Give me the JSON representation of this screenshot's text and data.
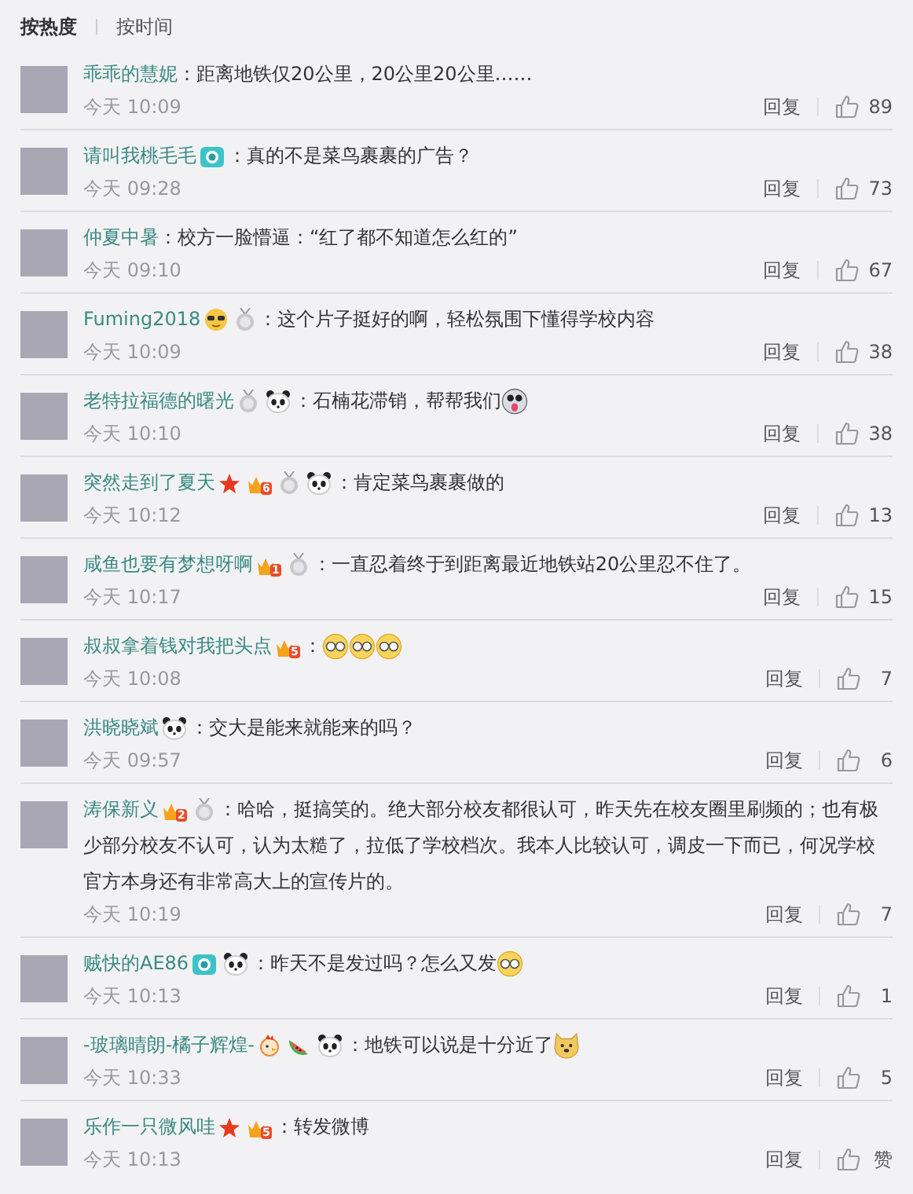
{
  "sort_tabs": [
    {
      "label": "按热度",
      "selected": true
    },
    {
      "label": "按时间",
      "selected": false
    }
  ],
  "comments": [
    {
      "name": "乖乖的慧妮",
      "text": "：距离地铁仅20公里，20公里20公里……",
      "time": "今天 10:09",
      "reply": "回复",
      "likes": "89"
    },
    {
      "name": "请叫我桃毛毛",
      "badges": [
        {
          "kind": "camera"
        }
      ],
      "text": "：真的不是菜鸟裹裹的广告？",
      "time": "今天 09:28",
      "reply": "回复",
      "likes": "73"
    },
    {
      "name": "仲夏中暑",
      "text": "：校方一脸懵逼：“红了都不知道怎么红的”",
      "time": "今天 09:10",
      "reply": "回复",
      "likes": "67"
    },
    {
      "name": "Fuming2018",
      "badges": [
        {
          "kind": "cool"
        },
        {
          "kind": "medal"
        }
      ],
      "text": "：这个片子挺好的啊，轻松氛围下懂得学校内容",
      "time": "今天 10:09",
      "reply": "回复",
      "likes": "38"
    },
    {
      "name": "老特拉福德的曙光",
      "badges": [
        {
          "kind": "medal"
        },
        {
          "kind": "panda"
        }
      ],
      "text": "：石楠花滞销，帮帮我们",
      "emojis": [
        {
          "kind": "tongue"
        }
      ],
      "time": "今天 10:10",
      "reply": "回复",
      "likes": "38"
    },
    {
      "name": "突然走到了夏天",
      "badges": [
        {
          "kind": "star"
        },
        {
          "kind": "crown",
          "number": "6"
        },
        {
          "kind": "medal"
        },
        {
          "kind": "panda"
        }
      ],
      "text": "：肯定菜鸟裹裹做的",
      "time": "今天 10:12",
      "reply": "回复",
      "likes": "13"
    },
    {
      "name": "咸鱼也要有梦想呀啊",
      "badges": [
        {
          "kind": "crown",
          "number": "1"
        },
        {
          "kind": "medal"
        }
      ],
      "text": "：一直忍着终于到距离最近地铁站20公里忍不住了。",
      "time": "今天 10:17",
      "reply": "回复",
      "likes": "15"
    },
    {
      "name": "叔叔拿着钱对我把头点",
      "badges": [
        {
          "kind": "crown",
          "number": "5"
        }
      ],
      "text": "：",
      "emojis": [
        {
          "kind": "glasses"
        },
        {
          "kind": "glasses"
        },
        {
          "kind": "glasses"
        }
      ],
      "time": "今天 10:08",
      "reply": "回复",
      "likes": "7"
    },
    {
      "name": "洪晓晓斌",
      "badges": [
        {
          "kind": "panda"
        }
      ],
      "text": "：交大是能来就能来的吗？",
      "time": "今天 09:57",
      "reply": "回复",
      "likes": "6"
    },
    {
      "name": "涛保新义",
      "badges": [
        {
          "kind": "crown",
          "number": "2"
        },
        {
          "kind": "medal"
        }
      ],
      "text": "：哈哈，挺搞笑的。绝大部分校友都很认可，昨天先在校友圈里刷频的；也有极少部分校友不认可，认为太糙了，拉低了学校档次。我本人比较认可，调皮一下而已，何况学校官方本身还有非常高大上的宣传片的。",
      "time": "今天 10:19",
      "reply": "回复",
      "likes": "7"
    },
    {
      "name": "贼快的AE86",
      "badges": [
        {
          "kind": "camera"
        },
        {
          "kind": "panda"
        }
      ],
      "text": "：昨天不是发过吗？怎么又发",
      "emojis": [
        {
          "kind": "glasses"
        }
      ],
      "time": "今天 10:13",
      "reply": "回复",
      "likes": "1"
    },
    {
      "name": "-玻璃晴朗-橘子辉煌-",
      "badges": [
        {
          "kind": "chicken"
        },
        {
          "kind": "watermelon"
        },
        {
          "kind": "panda"
        }
      ],
      "text": "：地铁可以说是十分近了",
      "emojis": [
        {
          "kind": "doge"
        }
      ],
      "time": "今天 10:33",
      "reply": "回复",
      "likes": "5"
    },
    {
      "name": "乐作一只微风哇",
      "badges": [
        {
          "kind": "star"
        },
        {
          "kind": "crown",
          "number": "5"
        }
      ],
      "text": "：转发微博",
      "time": "今天 10:13",
      "reply": "回复",
      "likes": "赞"
    }
  ]
}
